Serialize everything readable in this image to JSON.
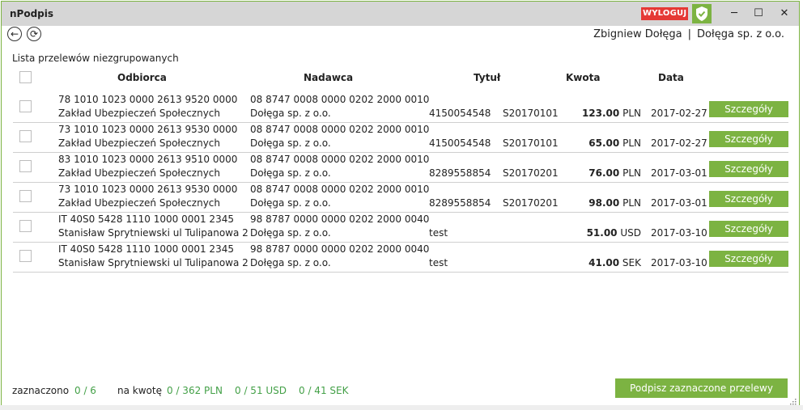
{
  "app": {
    "title": "nPodpis",
    "logout_label": "WYLOGUJ",
    "shield_icon": "shield-check-icon",
    "window_controls": {
      "minimize": "─",
      "maximize": "☐",
      "close": "✕"
    }
  },
  "toolbar": {
    "back_icon": "←",
    "refresh_icon": "⟳",
    "user_name": "Zbigniew Dołęga",
    "separator": "|",
    "company": "Dołęga sp. z o.o."
  },
  "list": {
    "title": "Lista przelewów niezgrupowanych",
    "headers": {
      "recipient": "Odbiorca",
      "sender": "Nadawca",
      "title": "Tytuł",
      "amount": "Kwota",
      "date": "Data"
    },
    "details_label": "Szczegóły",
    "rows": [
      {
        "recipient_account": "78 1010 1023 0000 2613 9520 0000",
        "recipient_name": "Zakład Ubezpieczeń Społecznych",
        "sender_account": "08 8747 0008 0000 0202 2000 0010",
        "sender_name": "Dołęga sp. z o.o.",
        "title_a": "4150054548",
        "title_b": "S20170101",
        "amount": "123.00",
        "currency": "PLN",
        "date": "2017-02-27"
      },
      {
        "recipient_account": "73 1010 1023 0000 2613 9530 0000",
        "recipient_name": "Zakład Ubezpieczeń Społecznych",
        "sender_account": "08 8747 0008 0000 0202 2000 0010",
        "sender_name": "Dołęga sp. z o.o.",
        "title_a": "4150054548",
        "title_b": "S20170101",
        "amount": "65.00",
        "currency": "PLN",
        "date": "2017-02-27"
      },
      {
        "recipient_account": "83 1010 1023 0000 2613 9510 0000",
        "recipient_name": "Zakład Ubezpieczeń Społecznych",
        "sender_account": "08 8747 0008 0000 0202 2000 0010",
        "sender_name": "Dołęga sp. z o.o.",
        "title_a": "8289558854",
        "title_b": "S20170201",
        "amount": "76.00",
        "currency": "PLN",
        "date": "2017-03-01"
      },
      {
        "recipient_account": "73 1010 1023 0000 2613 9530 0000",
        "recipient_name": "Zakład Ubezpieczeń Społecznych",
        "sender_account": "08 8747 0008 0000 0202 2000 0010",
        "sender_name": "Dołęga sp. z o.o.",
        "title_a": "8289558854",
        "title_b": "S20170201",
        "amount": "98.00",
        "currency": "PLN",
        "date": "2017-03-01"
      },
      {
        "recipient_account": "IT 40S0 5428 1110 1000 0001 2345",
        "recipient_name": "Stanisław Sprytniewski ul Tulipanowa 2",
        "sender_account": "98 8787 0000 0000 0202 2000 0040",
        "sender_name": "Dołęga sp. z o.o.",
        "title_a": "test",
        "title_b": "",
        "amount": "51.00",
        "currency": "USD",
        "date": "2017-03-10"
      },
      {
        "recipient_account": "IT 40S0 5428 1110 1000 0001 2345",
        "recipient_name": "Stanisław Sprytniewski ul Tulipanowa 2",
        "sender_account": "98 8787 0000 0000 0202 2000 0040",
        "sender_name": "Dołęga sp. z o.o.",
        "title_a": "test",
        "title_b": "",
        "amount": "41.00",
        "currency": "SEK",
        "date": "2017-03-10"
      }
    ]
  },
  "footer": {
    "selected_label": "zaznaczono",
    "selected_value": "0 / 6",
    "amount_label": "na kwotę",
    "amount_pln": "0 / 362 PLN",
    "amount_usd": "0 / 51 USD",
    "amount_sek": "0 / 41 SEK",
    "sign_button": "Podpisz zaznaczone przelewy"
  },
  "colors": {
    "accent": "#7cb342",
    "logout": "#e53935",
    "footer_values": "#43a047"
  }
}
